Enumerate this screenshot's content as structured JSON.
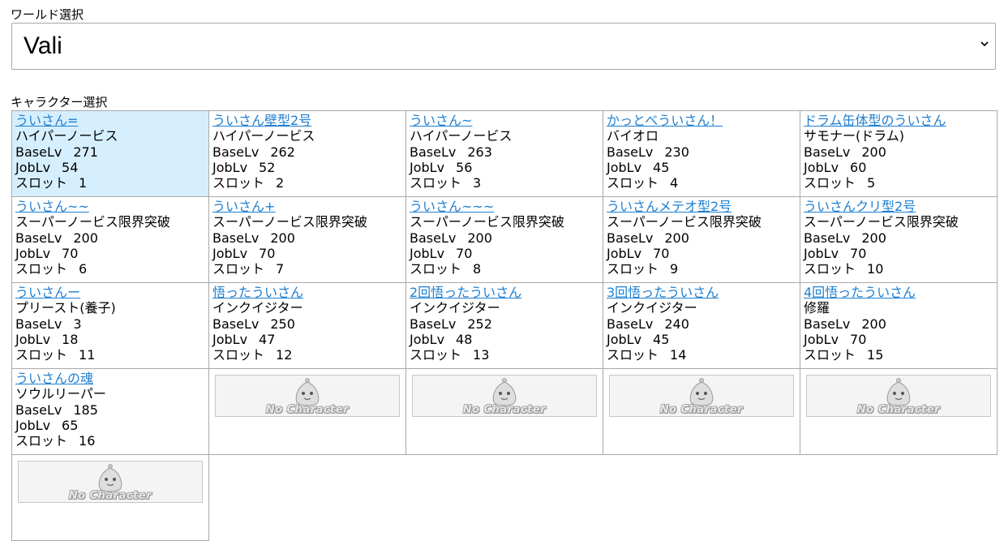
{
  "world": {
    "label": "ワールド選択",
    "selected": "Vali"
  },
  "character": {
    "label": "キャラクター選択",
    "fields": {
      "base": "BaseLv",
      "job": "JobLv",
      "slot": "スロット"
    },
    "empty_text": "No Character",
    "slots": [
      {
        "name": "ういさん=",
        "job": "ハイパーノービス",
        "base": "271",
        "joblv": "54",
        "slot": "1",
        "selected": true
      },
      {
        "name": "ういさん壁型2号",
        "job": "ハイパーノービス",
        "base": "262",
        "joblv": "52",
        "slot": "2"
      },
      {
        "name": "ういさん~",
        "job": "ハイパーノービス",
        "base": "263",
        "joblv": "56",
        "slot": "3"
      },
      {
        "name": "かっとべういさん！",
        "job": "バイオロ",
        "base": "230",
        "joblv": "45",
        "slot": "4"
      },
      {
        "name": "ドラム缶体型のういさん",
        "job": "サモナー(ドラム)",
        "base": "200",
        "joblv": "60",
        "slot": "5"
      },
      {
        "name": "ういさん~~",
        "job": "スーパーノービス限界突破",
        "base": "200",
        "joblv": "70",
        "slot": "6"
      },
      {
        "name": "ういさん+",
        "job": "スーパーノービス限界突破",
        "base": "200",
        "joblv": "70",
        "slot": "7"
      },
      {
        "name": "ういさん~~~",
        "job": "スーパーノービス限界突破",
        "base": "200",
        "joblv": "70",
        "slot": "8"
      },
      {
        "name": "ういさんメテオ型2号",
        "job": "スーパーノービス限界突破",
        "base": "200",
        "joblv": "70",
        "slot": "9"
      },
      {
        "name": "ういさんクリ型2号",
        "job": "スーパーノービス限界突破",
        "base": "200",
        "joblv": "70",
        "slot": "10"
      },
      {
        "name": "ういさんー",
        "job": "プリースト(養子)",
        "base": "3",
        "joblv": "18",
        "slot": "11"
      },
      {
        "name": "悟ったういさん",
        "job": "インクイジター",
        "base": "250",
        "joblv": "47",
        "slot": "12"
      },
      {
        "name": "2回悟ったういさん",
        "job": "インクイジター",
        "base": "252",
        "joblv": "48",
        "slot": "13"
      },
      {
        "name": "3回悟ったういさん",
        "job": "インクイジター",
        "base": "240",
        "joblv": "45",
        "slot": "14"
      },
      {
        "name": "4回悟ったういさん",
        "job": "修羅",
        "base": "200",
        "joblv": "70",
        "slot": "15"
      },
      {
        "name": "ういさんの魂",
        "job": "ソウルリーパー",
        "base": "185",
        "joblv": "65",
        "slot": "16"
      },
      {
        "empty": true
      },
      {
        "empty": true
      },
      {
        "empty": true
      },
      {
        "empty": true
      },
      {
        "empty": true
      }
    ]
  }
}
